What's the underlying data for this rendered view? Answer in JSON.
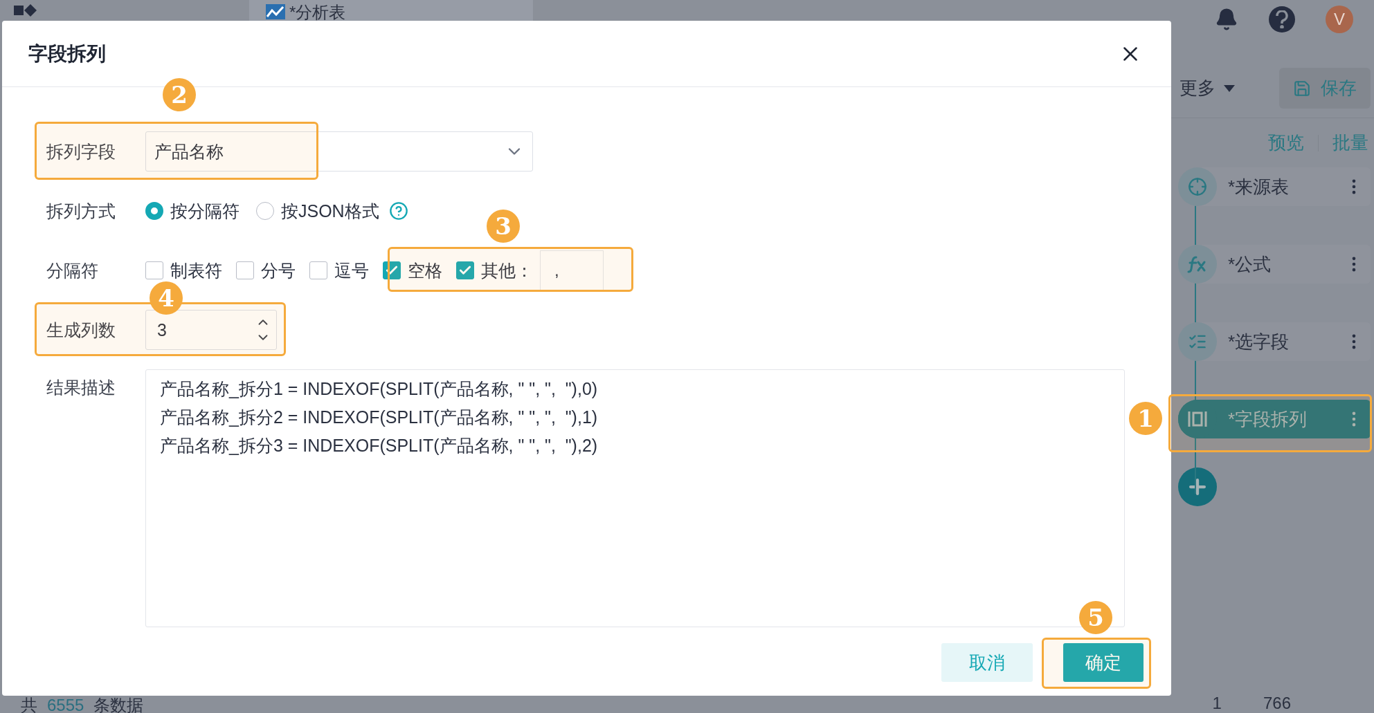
{
  "app": {
    "tab": "*分析表",
    "avatar": "V",
    "toolbar": {
      "more": "更多",
      "save": "保存"
    },
    "panel_links": [
      "预览",
      "批量"
    ],
    "nodes": [
      {
        "label": "*来源表",
        "kind": "source",
        "selected": false
      },
      {
        "label": "*公式",
        "kind": "formula",
        "selected": false
      },
      {
        "label": "*选字段",
        "kind": "select",
        "selected": false
      },
      {
        "label": "*字段拆列",
        "kind": "split",
        "selected": true
      }
    ],
    "footer": {
      "prefix": "共",
      "count": "6555",
      "suffix": "条数据",
      "page": "1",
      "total": "766"
    }
  },
  "dialog": {
    "title": "字段拆列",
    "split_field": {
      "label": "拆列字段",
      "value": "产品名称"
    },
    "method": {
      "label": "拆列方式",
      "options": [
        {
          "label": "按分隔符",
          "selected": true
        },
        {
          "label": "按JSON格式",
          "selected": false
        }
      ]
    },
    "separators": {
      "label": "分隔符",
      "options": [
        {
          "label": "制表符",
          "checked": false
        },
        {
          "label": "分号",
          "checked": false
        },
        {
          "label": "逗号",
          "checked": false
        },
        {
          "label": "空格",
          "checked": true
        },
        {
          "label": "其他：",
          "checked": true
        }
      ],
      "other_value": ","
    },
    "columns": {
      "label": "生成列数",
      "value": "3"
    },
    "result": {
      "label": "结果描述",
      "lines": [
        "产品名称_拆分1 = INDEXOF(SPLIT(产品名称, \" \", \",  \"),0)",
        "产品名称_拆分2 = INDEXOF(SPLIT(产品名称, \" \", \",  \"),1)",
        "产品名称_拆分3 = INDEXOF(SPLIT(产品名称, \" \", \",  \"),2)"
      ]
    },
    "buttons": [
      {
        "label": "取消",
        "kind": "secondary"
      },
      {
        "label": "确定",
        "kind": "primary"
      }
    ]
  },
  "annotations": [
    {
      "number": "1"
    },
    {
      "number": "2"
    },
    {
      "number": "3"
    },
    {
      "number": "4"
    },
    {
      "number": "5"
    }
  ]
}
